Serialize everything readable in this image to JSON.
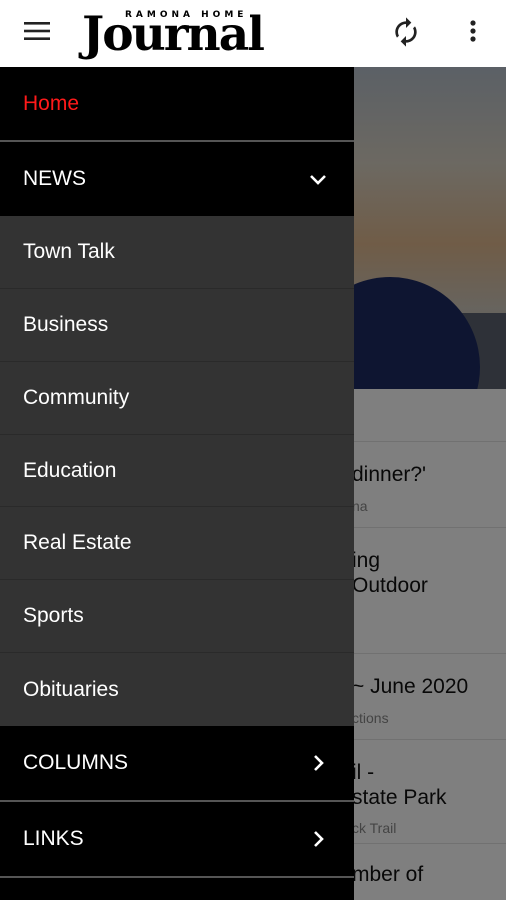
{
  "appbar": {
    "logo_tagline": "RAMONA HOME",
    "logo_word": "Journal",
    "icons": {
      "menu": "hamburger-menu-icon",
      "refresh": "refresh-icon",
      "more": "more-vertical-icon"
    }
  },
  "drawer": {
    "home": "Home",
    "news": "NEWS",
    "news_items": [
      "Town Talk",
      "Business",
      "Community",
      "Education",
      "Real Estate",
      "Sports",
      "Obituaries"
    ],
    "columns": "COLUMNS",
    "links": "LINKS"
  },
  "articles": [
    {
      "title": "dinner?'",
      "subtitle": "na"
    },
    {
      "title_line1": "ing",
      "title_line2": " Outdoor"
    },
    {
      "title": "~ June 2020",
      "subtitle": "ctions"
    },
    {
      "title_line1": "il -",
      "title_line2": "state Park",
      "subtitle": "ck Trail"
    },
    {
      "title": "mber of"
    }
  ],
  "colors": {
    "accent": "#ff1a1a",
    "drawer_bg": "#333333",
    "section_bg": "#000000"
  }
}
